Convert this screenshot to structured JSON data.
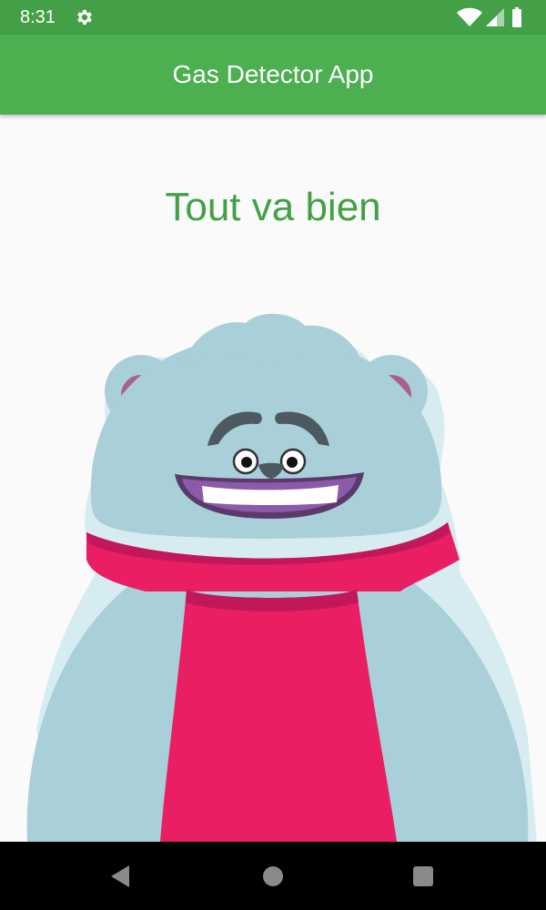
{
  "status_bar": {
    "time": "8:31",
    "icons": [
      "gear-icon",
      "wifi-icon",
      "cellular-signal-icon",
      "battery-icon"
    ]
  },
  "app_bar": {
    "title": "Gas Detector App"
  },
  "main": {
    "status_message": "Tout va bien",
    "mascot": "smiling-bear-with-red-scarf"
  },
  "nav_bar": {
    "buttons": [
      "back-icon",
      "home-icon",
      "recents-icon"
    ]
  },
  "colors": {
    "status_bar": "#43a047",
    "app_bar": "#4caf50",
    "status_text": "#43a047",
    "background": "#fafafa",
    "bear_fur": "#a9cfd9",
    "scarf": "#e91e63"
  }
}
